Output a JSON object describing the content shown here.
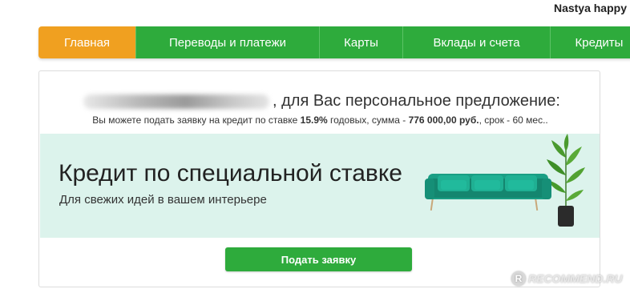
{
  "user": {
    "name": "Nastya happy"
  },
  "nav": {
    "items": [
      {
        "label": "Главная",
        "active": true
      },
      {
        "label": "Переводы и платежи",
        "active": false
      },
      {
        "label": "Карты",
        "active": false
      },
      {
        "label": "Вклады и счета",
        "active": false
      },
      {
        "label": "Кредиты",
        "active": false
      }
    ]
  },
  "offer": {
    "greeting_suffix": ", для Вас персональное предложение:",
    "line_prefix": "Вы можете подать заявку на кредит по ставке ",
    "rate": "15.9%",
    "line_mid": " годовых, сумма - ",
    "amount": "776 000,00 руб.",
    "line_suffix": ", срок - 60 мес.."
  },
  "banner": {
    "title": "Кредит по специальной ставке",
    "subtitle": "Для свежих идей в вашем интерьере",
    "background_color": "#dcf3ec",
    "sofa_color": "#1a9e84"
  },
  "apply_button": {
    "label": "Подать заявку"
  },
  "watermark": {
    "text": "RECOMMEND.RU",
    "icon": "R"
  },
  "colors": {
    "nav_green": "#2eab3c",
    "nav_active_orange": "#f0a020",
    "button_green": "#2eab3c"
  }
}
